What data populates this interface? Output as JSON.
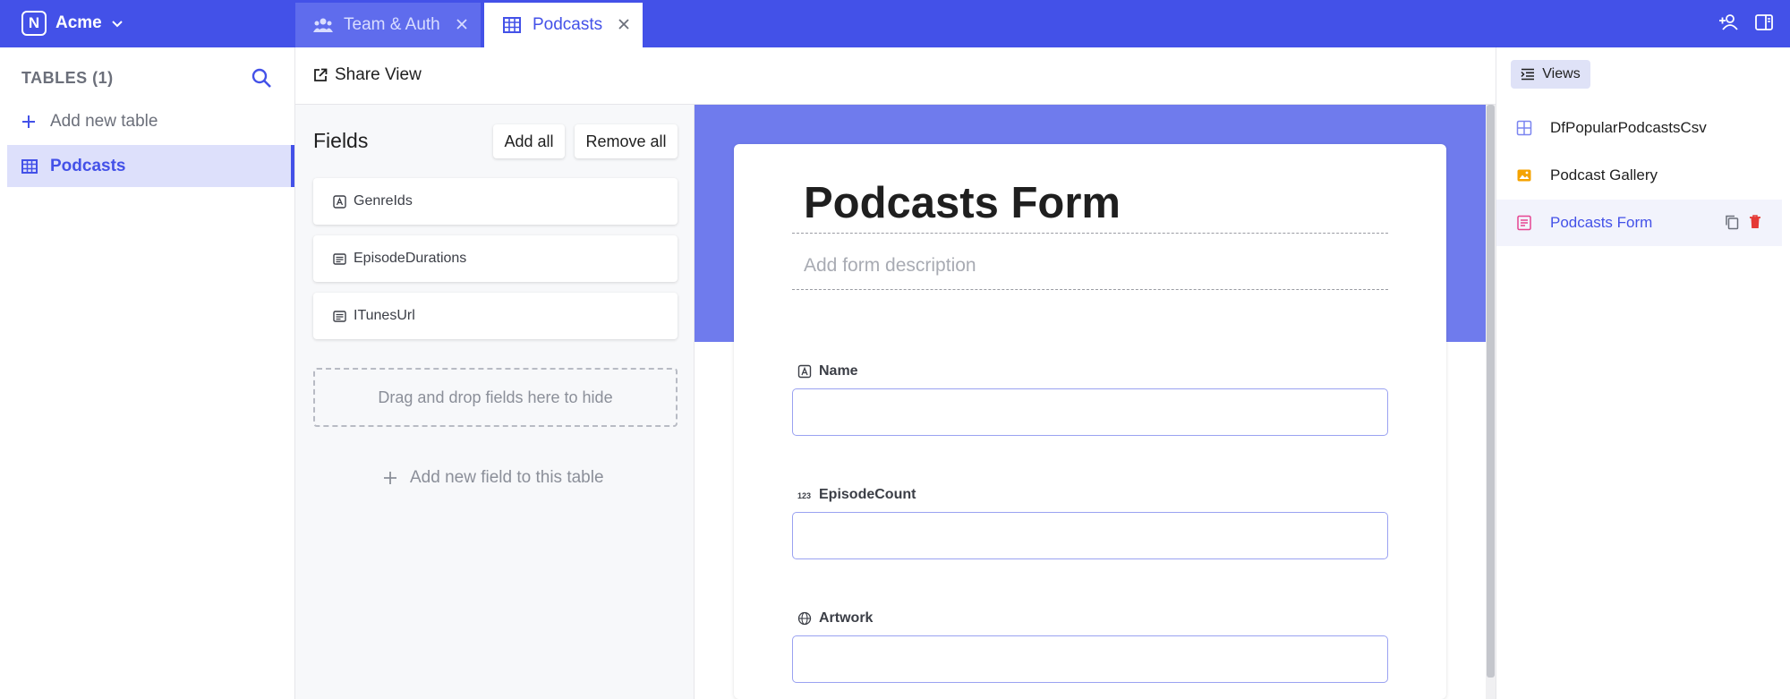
{
  "topbar": {
    "workspace": "Acme",
    "logo_letter": "N",
    "tabs": [
      {
        "label": "Team & Auth",
        "icon": "users-icon"
      },
      {
        "label": "Podcasts",
        "icon": "table-grid-icon"
      }
    ]
  },
  "sidebar": {
    "title": "TABLES (1)",
    "add_table": "Add new table",
    "tables": [
      {
        "label": "Podcasts",
        "icon": "table-grid-icon"
      }
    ]
  },
  "toolbar": {
    "share_view": "Share View"
  },
  "fields_panel": {
    "title": "Fields",
    "add_all": "Add all",
    "remove_all": "Remove all",
    "hidden_fields": [
      {
        "label": "GenreIds",
        "icon": "text-field-icon"
      },
      {
        "label": "EpisodeDurations",
        "icon": "long-text-icon"
      },
      {
        "label": "ITunesUrl",
        "icon": "long-text-icon"
      }
    ],
    "drop_zone": "Drag and drop fields here to hide",
    "add_field": "Add new field to this table"
  },
  "form": {
    "title": "Podcasts Form",
    "description_placeholder": "Add form description",
    "questions": [
      {
        "label": "Name",
        "icon": "text-field-icon",
        "value": ""
      },
      {
        "label": "EpisodeCount",
        "icon": "number-icon",
        "value": ""
      },
      {
        "label": "Artwork",
        "icon": "globe-icon",
        "value": ""
      }
    ]
  },
  "views_panel": {
    "button": "Views",
    "views": [
      {
        "label": "DfPopularPodcastsCsv",
        "icon": "grid-view-icon"
      },
      {
        "label": "Podcast Gallery",
        "icon": "gallery-view-icon"
      },
      {
        "label": "Podcasts Form",
        "icon": "form-view-icon",
        "active": true
      }
    ]
  },
  "colors": {
    "accent": "#4351e8",
    "form_band": "#6f7bed",
    "gallery_icon": "#f5a300",
    "form_icon": "#e64591",
    "delete": "#e53935"
  }
}
